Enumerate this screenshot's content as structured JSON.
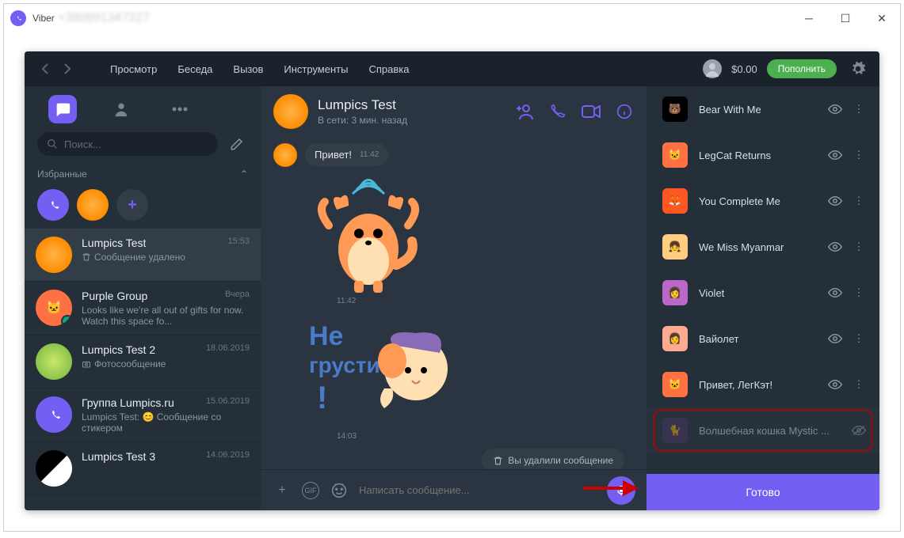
{
  "window": {
    "title": "Viber",
    "phone": "+380991347227"
  },
  "menu": {
    "view": "Просмотр",
    "conversation": "Беседа",
    "call": "Вызов",
    "tools": "Инструменты",
    "help": "Справка"
  },
  "topbar": {
    "balance": "$0.00",
    "topup": "Пополнить"
  },
  "sidebar": {
    "search_placeholder": "Поиск...",
    "favorites_label": "Избранные",
    "chats": [
      {
        "name": "Lumpics Test",
        "time": "15:53",
        "msg": "Сообщение удалено",
        "selected": true,
        "avatar": "orange"
      },
      {
        "name": "Purple Group",
        "time": "Вчера",
        "msg": "Looks like we're all out of gifts for now. Watch this space fo...",
        "avatar": "cat",
        "badge": true
      },
      {
        "name": "Lumpics Test 2",
        "time": "18.06.2019",
        "msg": "Фотосообщение",
        "icon": "camera",
        "avatar": "lime"
      },
      {
        "name": "Группа Lumpics.ru",
        "time": "15.06.2019",
        "msg": "Lumpics Test: 😊 Сообщение со стикером",
        "avatar": "viber"
      },
      {
        "name": "Lumpics Test 3",
        "time": "14.06.2019",
        "msg": "",
        "avatar": "bw"
      }
    ]
  },
  "chat": {
    "name": "Lumpics Test",
    "status": "В сети: 3 мин. назад",
    "messages": {
      "greeting": {
        "text": "Привет!",
        "time": "11:42"
      },
      "sticker1_time": "11:42",
      "sticker2_text": "Не грусти !",
      "sticker2_time": "14:03",
      "deleted": "Вы удалили сообщение"
    },
    "input_placeholder": "Написать сообщение..."
  },
  "stickers": {
    "packs": [
      {
        "name": "Bear With Me",
        "avatar": "bear"
      },
      {
        "name": "LegCat Returns",
        "avatar": "cat"
      },
      {
        "name": "You Complete Me",
        "avatar": "fox"
      },
      {
        "name": "We Miss Myanmar",
        "avatar": "girl"
      },
      {
        "name": "Violet",
        "avatar": "violet"
      },
      {
        "name": "Вайолет",
        "avatar": "violet2"
      },
      {
        "name": "Привет, ЛегКэт!",
        "avatar": "cat"
      },
      {
        "name": "Волшебная кошка Mystic ...",
        "avatar": "mystic",
        "hidden": true,
        "highlighted": true
      }
    ],
    "done": "Готово"
  }
}
